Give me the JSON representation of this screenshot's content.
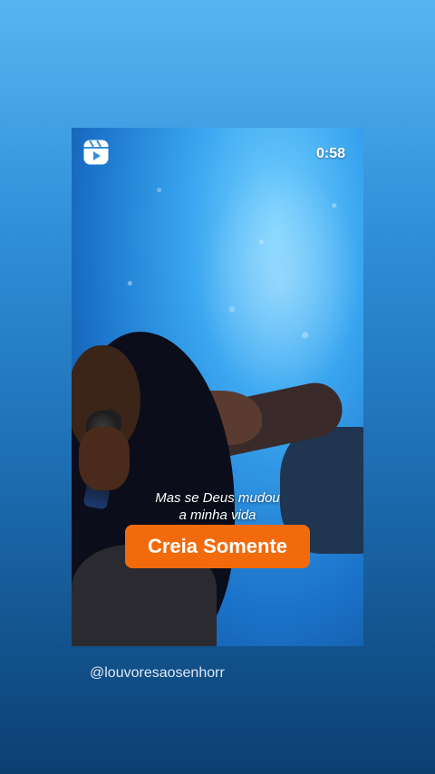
{
  "story": {
    "timer": "0:58",
    "caption_line1": "Mas se Deus mudou",
    "caption_line2": "a minha vida",
    "highlight_text": "Creia Somente",
    "username": "@louvoresaosenhorr"
  },
  "icons": {
    "reels": "reels-icon"
  },
  "colors": {
    "highlight": "#f26a0c",
    "background_top": "#56b6f2",
    "background_bottom": "#0b3f72"
  }
}
